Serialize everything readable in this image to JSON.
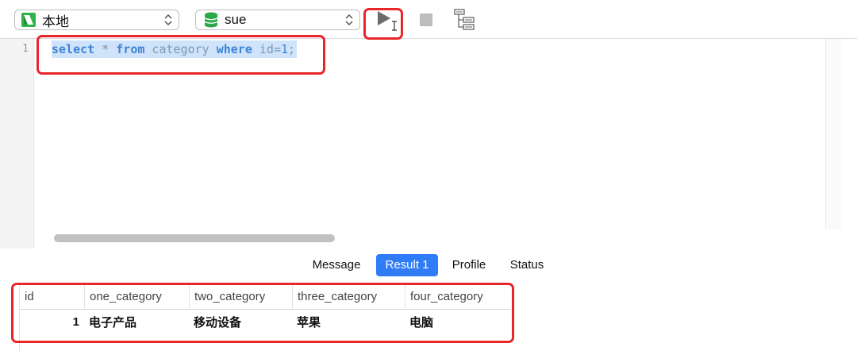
{
  "toolbar": {
    "connection": {
      "label": "本地",
      "icon": "navicat-connection-icon"
    },
    "database": {
      "label": "sue",
      "icon": "database-icon"
    },
    "buttons": [
      {
        "name": "run-button",
        "icon": "play-icon"
      },
      {
        "name": "stop-button",
        "icon": "stop-icon"
      },
      {
        "name": "explain-button",
        "icon": "explain-icon"
      }
    ]
  },
  "editor": {
    "line_number": "1",
    "tokens": {
      "t1": "select",
      "t2": " * ",
      "t3": "from",
      "t4": " category ",
      "t5": "where",
      "t6": " id=",
      "t7": "1",
      "t8": ";"
    }
  },
  "result_tabs": [
    {
      "label": "Message",
      "active": false
    },
    {
      "label": "Result 1",
      "active": true
    },
    {
      "label": "Profile",
      "active": false
    },
    {
      "label": "Status",
      "active": false
    }
  ],
  "grid": {
    "columns": [
      "id",
      "one_category",
      "two_category",
      "three_category",
      "four_category"
    ],
    "rows": [
      [
        "1",
        "电子产品",
        "移动设备",
        "苹果",
        "电脑"
      ]
    ]
  },
  "colors": {
    "accent": "#2f7cf6",
    "annotation": "#e8262a",
    "selection": "#cfe3fb",
    "keyword": "#3f84d4"
  }
}
